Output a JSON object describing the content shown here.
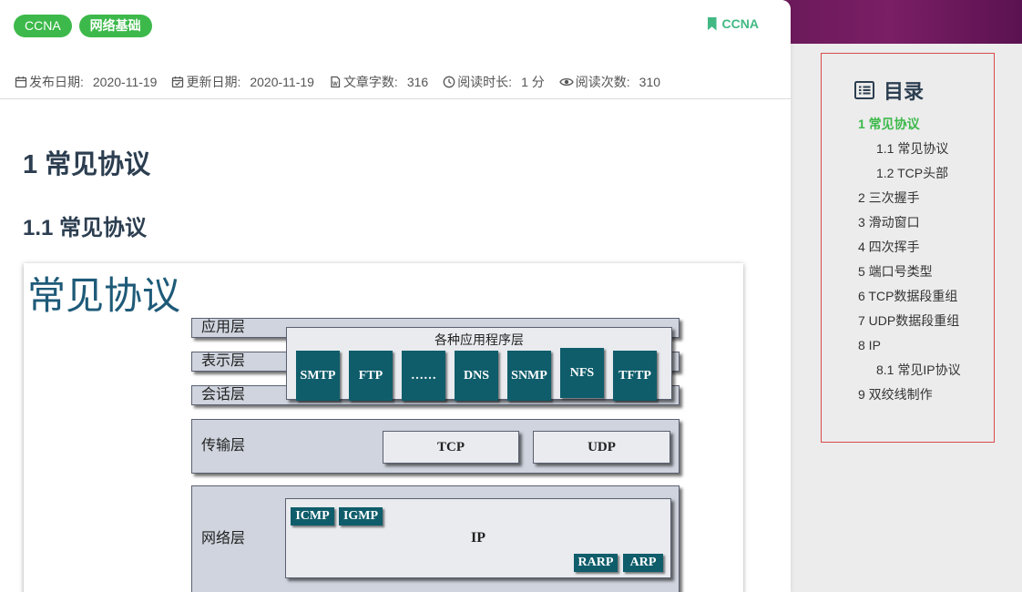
{
  "tags": [
    "CCNA",
    "网络基础"
  ],
  "category": "CCNA",
  "meta": [
    {
      "icon": "calendar-icon",
      "label": "发布日期:",
      "value": "2020-11-19"
    },
    {
      "icon": "calendar-check-icon",
      "label": "更新日期:",
      "value": "2020-11-19"
    },
    {
      "icon": "word-doc-icon",
      "label": "文章字数:",
      "value": "316"
    },
    {
      "icon": "clock-icon",
      "label": "阅读时长:",
      "value": "1 分"
    },
    {
      "icon": "eye-icon",
      "label": "阅读次数:",
      "value": "310"
    }
  ],
  "article": {
    "h1": "1 常见协议",
    "h2": "1.1 常见协议"
  },
  "figure": {
    "title": "常见协议",
    "layers": {
      "app": "应用层",
      "pres": "表示层",
      "session": "会话层",
      "transport": "传输层",
      "network": "网络层"
    },
    "app_box_title": "各种应用程序层",
    "app_protocols": [
      "SMTP",
      "FTP",
      "……",
      "DNS",
      "SNMP",
      "NFS",
      "TFTP"
    ],
    "transport_protocols": [
      "TCP",
      "UDP"
    ],
    "ip_label": "IP",
    "net_top": [
      "ICMP",
      "IGMP"
    ],
    "net_bottom": [
      "RARP",
      "ARP"
    ]
  },
  "toc": {
    "title": "目录",
    "items": [
      {
        "label": "1 常见协议",
        "level": 1,
        "active": true
      },
      {
        "label": "1.1 常见协议",
        "level": 2,
        "active": false
      },
      {
        "label": "1.2 TCP头部",
        "level": 2,
        "active": false
      },
      {
        "label": "2 三次握手",
        "level": 1,
        "active": false
      },
      {
        "label": "3 滑动窗口",
        "level": 1,
        "active": false
      },
      {
        "label": "4 四次挥手",
        "level": 1,
        "active": false
      },
      {
        "label": "5 端口号类型",
        "level": 1,
        "active": false
      },
      {
        "label": "6 TCP数据段重组",
        "level": 1,
        "active": false
      },
      {
        "label": "7 UDP数据段重组",
        "level": 1,
        "active": false
      },
      {
        "label": "8 IP",
        "level": 1,
        "active": false
      },
      {
        "label": "8.1 常见IP协议",
        "level": 2,
        "active": false
      },
      {
        "label": "9 双绞线制作",
        "level": 1,
        "active": false
      }
    ]
  },
  "colors": {
    "accent": "#3cb94a",
    "heading": "#2c3e50",
    "protocol_box": "#0f5d6b",
    "toc_border": "#d84b4b"
  }
}
